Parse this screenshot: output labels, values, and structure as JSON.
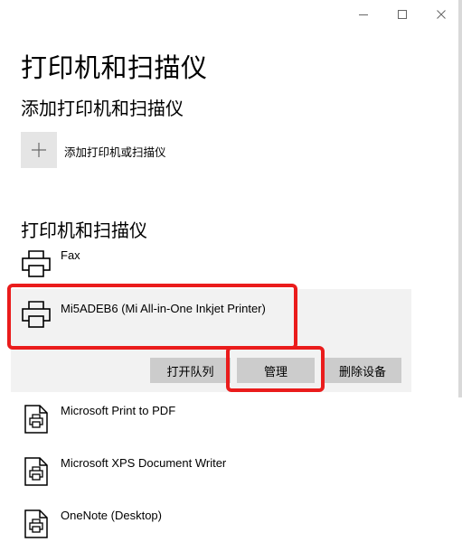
{
  "window": {
    "controls": {
      "minimize_icon": "minimize-icon",
      "maximize_icon": "maximize-icon",
      "close_icon": "close-icon"
    }
  },
  "page": {
    "title": "打印机和扫描仪"
  },
  "add_section": {
    "heading": "添加打印机和扫描仪",
    "add_button_label": "添加打印机或扫描仪",
    "add_icon": "plus-icon"
  },
  "list_section": {
    "heading": "打印机和扫描仪",
    "devices": [
      {
        "name": "Fax",
        "icon": "printer-icon"
      },
      {
        "name": "Mi5ADEB6 (Mi All-in-One Inkjet Printer)",
        "icon": "printer-icon",
        "selected": true
      },
      {
        "name": "Microsoft Print to PDF",
        "icon": "document-printer-icon"
      },
      {
        "name": "Microsoft XPS Document Writer",
        "icon": "document-printer-icon"
      },
      {
        "name": "OneNote (Desktop)",
        "icon": "document-printer-icon"
      }
    ],
    "actions": {
      "open_queue": "打开队列",
      "manage": "管理",
      "remove_device": "删除设备"
    }
  },
  "colors": {
    "highlight": "#ea1c1c",
    "selected_bg": "#f2f2f2",
    "button_bg": "#cccccc",
    "tile_bg": "#e5e5e5"
  }
}
